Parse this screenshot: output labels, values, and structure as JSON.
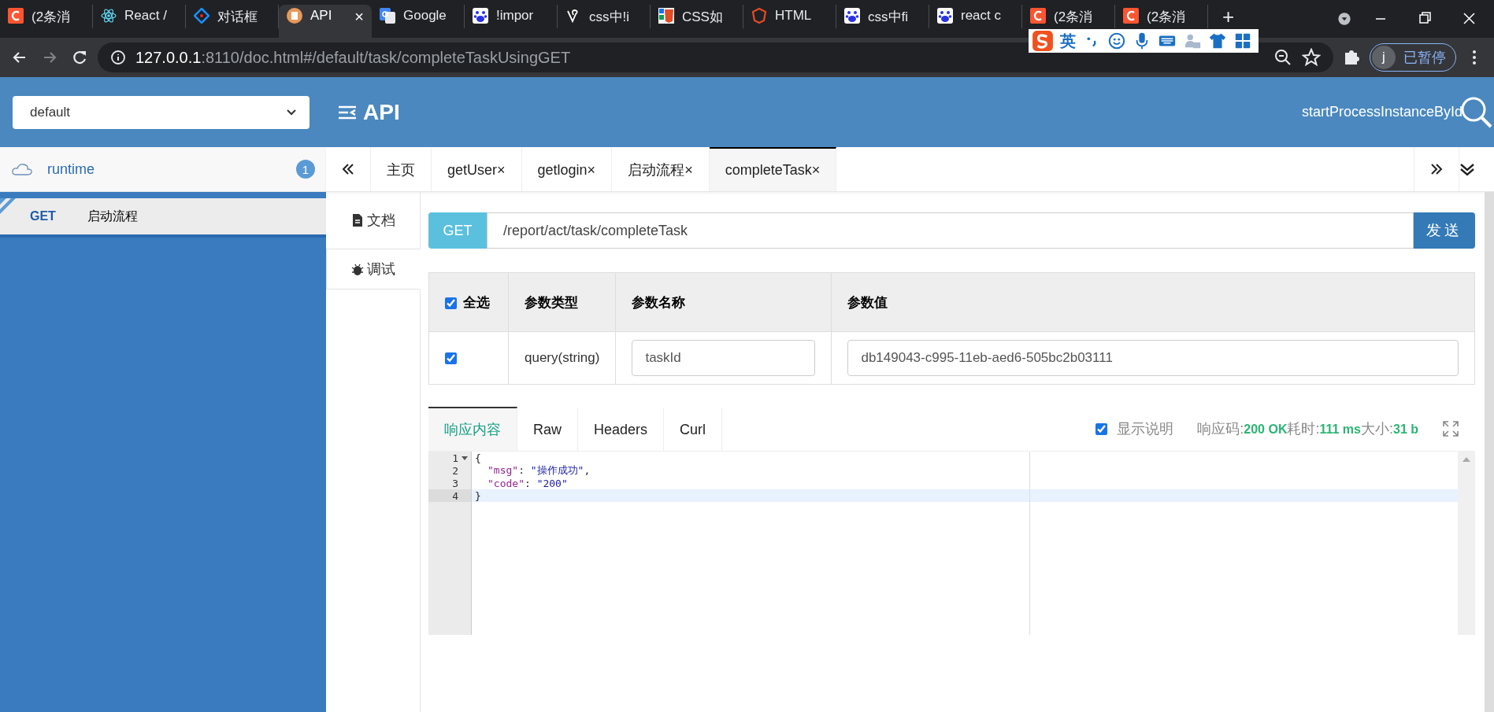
{
  "browser": {
    "tabs": [
      {
        "title": "(2条消",
        "selected": false
      },
      {
        "title": "React /",
        "selected": false
      },
      {
        "title": "对话框",
        "selected": false
      },
      {
        "title": "API",
        "selected": true,
        "close": "×"
      },
      {
        "title": "Google",
        "selected": false
      },
      {
        "title": "!impor",
        "selected": false
      },
      {
        "title": "css中!i",
        "selected": false
      },
      {
        "title": "CSS如",
        "selected": false
      },
      {
        "title": "HTML",
        "selected": false
      },
      {
        "title": "css中fi",
        "selected": false
      },
      {
        "title": "react c",
        "selected": false
      },
      {
        "title": "(2条消",
        "selected": false
      },
      {
        "title": "(2条消",
        "selected": false
      }
    ],
    "new_tab": "+",
    "url_host": "127.0.0.1",
    "url_path": ":8110/doc.html#/default/task/completeTaskUsingGET",
    "profile_initial": "j",
    "profile_label": "已暂停"
  },
  "ime": {
    "label": "英"
  },
  "header": {
    "group_select": "default",
    "logo": "API",
    "search_text": "startProcessInstanceById"
  },
  "sidebar": {
    "groups": [
      {
        "name": "runtime",
        "count": "1",
        "children": [
          {
            "method": "GET",
            "name": "启动流程",
            "is_new": true,
            "selected": true
          }
        ]
      }
    ]
  },
  "doc_tabs": [
    {
      "label": "主页",
      "selected": false
    },
    {
      "label": "getUser",
      "close": "×",
      "selected": false
    },
    {
      "label": "getlogin",
      "close": "×",
      "selected": false
    },
    {
      "label": "启动流程",
      "close": "×",
      "selected": false
    },
    {
      "label": "completeTask",
      "close": "×",
      "selected": true
    }
  ],
  "side_tabs": [
    {
      "label": "文档",
      "selected": false
    },
    {
      "label": "调试",
      "selected": true
    }
  ],
  "request": {
    "method": "GET",
    "url": "/report/act/task/completeTask",
    "send": "发送"
  },
  "params": {
    "select_all": {
      "label": "全选",
      "checked": true
    },
    "columns": [
      "参数类型",
      "参数名称",
      "参数值"
    ],
    "rows": [
      {
        "checked": true,
        "type": "query(string)",
        "name": "taskId",
        "value": "db149043-c995-11eb-aed6-505bc2b03111"
      }
    ]
  },
  "response": {
    "tabs": [
      {
        "label": "响应内容",
        "selected": true
      },
      {
        "label": "Raw",
        "selected": false
      },
      {
        "label": "Headers",
        "selected": false
      },
      {
        "label": "Curl",
        "selected": false
      }
    ],
    "show_desc": {
      "label": "显示说明",
      "checked": true
    },
    "stats": [
      {
        "label": "响应码:",
        "value": "200 OK"
      },
      {
        "label": "耗时:",
        "value": "111 ms"
      },
      {
        "label": "大小:",
        "value": "31 b"
      }
    ],
    "lines": [
      {
        "number": "1",
        "foldable": true,
        "active": false,
        "indented": false,
        "tokens": [
          {
            "kind": "punct",
            "text": "{"
          }
        ]
      },
      {
        "number": "2",
        "foldable": false,
        "active": false,
        "indented": true,
        "tokens": [
          {
            "kind": "key",
            "text": "\"msg\""
          },
          {
            "kind": "punct",
            "text": ": "
          },
          {
            "kind": "string",
            "text": "\"操作成功\""
          },
          {
            "kind": "punct",
            "text": ","
          }
        ]
      },
      {
        "number": "3",
        "foldable": false,
        "active": false,
        "indented": true,
        "tokens": [
          {
            "kind": "key",
            "text": "\"code\""
          },
          {
            "kind": "punct",
            "text": ": "
          },
          {
            "kind": "string",
            "text": "\"200\""
          }
        ]
      },
      {
        "number": "4",
        "foldable": false,
        "active": true,
        "indented": false,
        "tokens": [
          {
            "kind": "punct",
            "text": "}"
          }
        ]
      }
    ]
  }
}
